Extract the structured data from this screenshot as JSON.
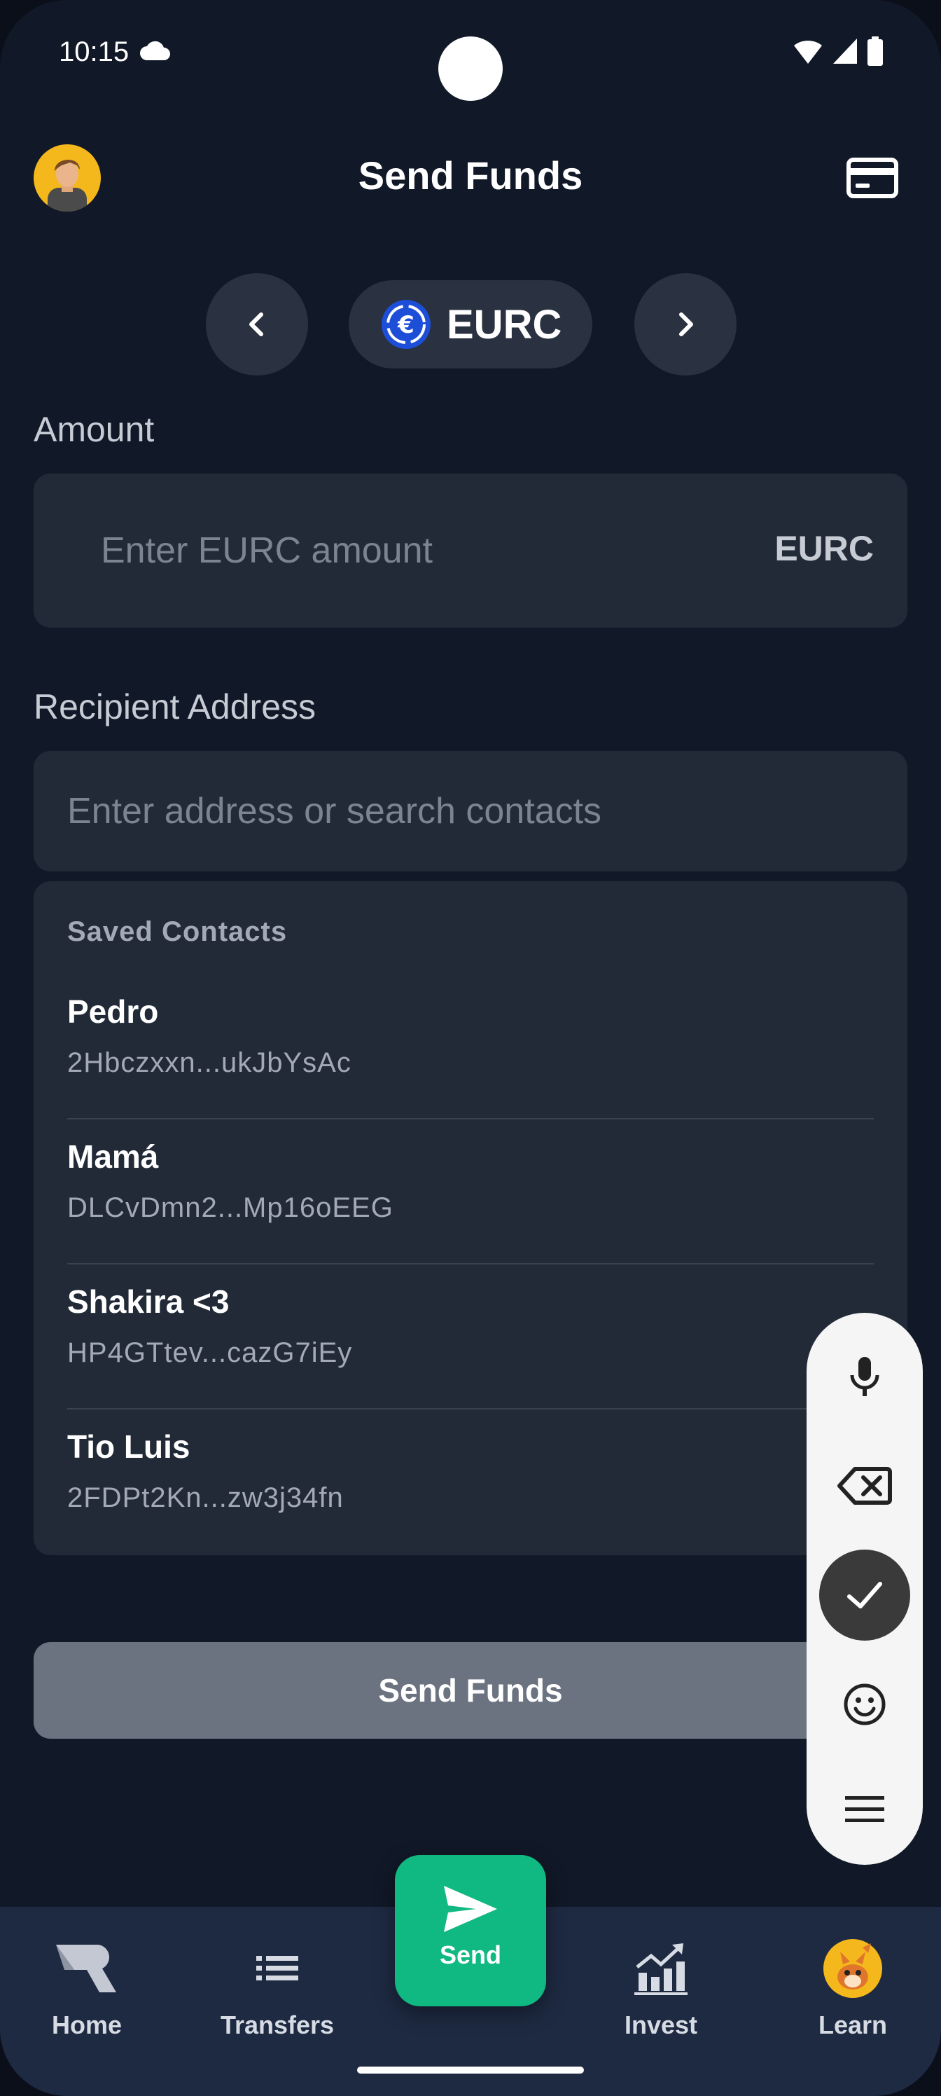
{
  "status_bar": {
    "time": "10:15"
  },
  "header": {
    "title": "Send Funds"
  },
  "currency": {
    "symbol": "EURC",
    "icon": "euro-coin-icon"
  },
  "amount": {
    "label": "Amount",
    "placeholder": "Enter EURC amount",
    "suffix": "EURC",
    "value": ""
  },
  "recipient": {
    "label": "Recipient Address",
    "placeholder": "Enter address or search contacts",
    "value": ""
  },
  "contacts": {
    "header": "Saved Contacts",
    "items": [
      {
        "name": "Pedro",
        "address": "2Hbczxxn...ukJbYsAc"
      },
      {
        "name": "Mamá",
        "address": "DLCvDmn2...Mp16oEEG"
      },
      {
        "name": "Shakira <3",
        "address": "HP4GTtev...cazG7iEy"
      },
      {
        "name": "Tio Luis",
        "address": "2FDPt2Kn...zw3j34fn"
      }
    ]
  },
  "actions": {
    "send_label": "Send Funds"
  },
  "keyboard_toolbar": {
    "icons": [
      "mic-icon",
      "backspace-icon",
      "check-icon",
      "emoji-icon",
      "menu-icon"
    ]
  },
  "bottom_nav": {
    "home": "Home",
    "transfers": "Transfers",
    "send": "Send",
    "invest": "Invest",
    "learn": "Learn"
  },
  "colors": {
    "background": "#111827",
    "surface": "#222a38",
    "accent": "#10b981",
    "disabled_button": "#6b7280",
    "nav_background": "#1e2a42"
  }
}
